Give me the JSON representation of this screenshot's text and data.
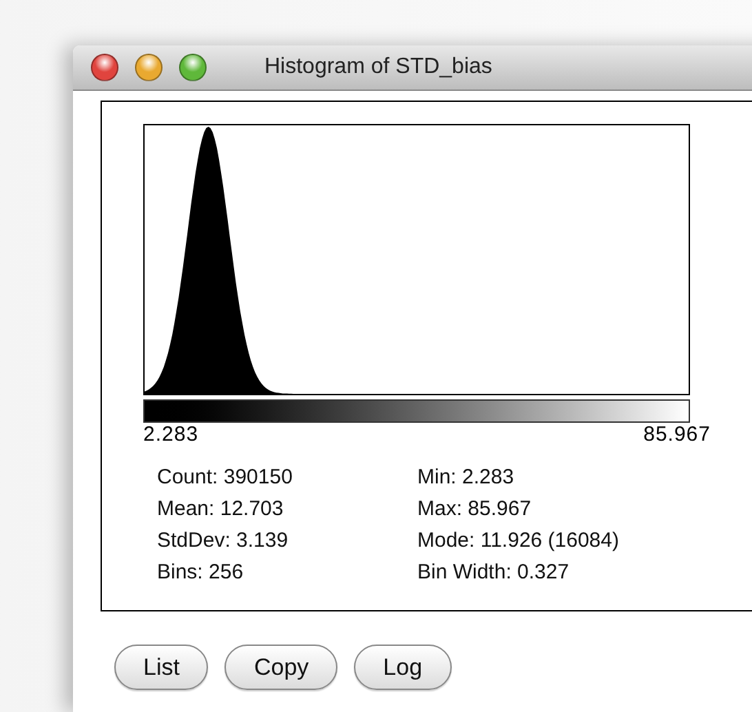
{
  "window": {
    "title": "Histogram of STD_bias"
  },
  "histogram": {
    "min_label": "2.283",
    "max_label": "85.967"
  },
  "stats_left": [
    "Count: 390150",
    "Mean: 12.703",
    "StdDev: 3.139",
    "Bins: 256"
  ],
  "stats_right": [
    "Min: 2.283",
    "Max: 85.967",
    "Mode: 11.926 (16084)",
    "Bin Width: 0.327"
  ],
  "buttons": [
    "List",
    "Copy",
    "Log"
  ]
}
